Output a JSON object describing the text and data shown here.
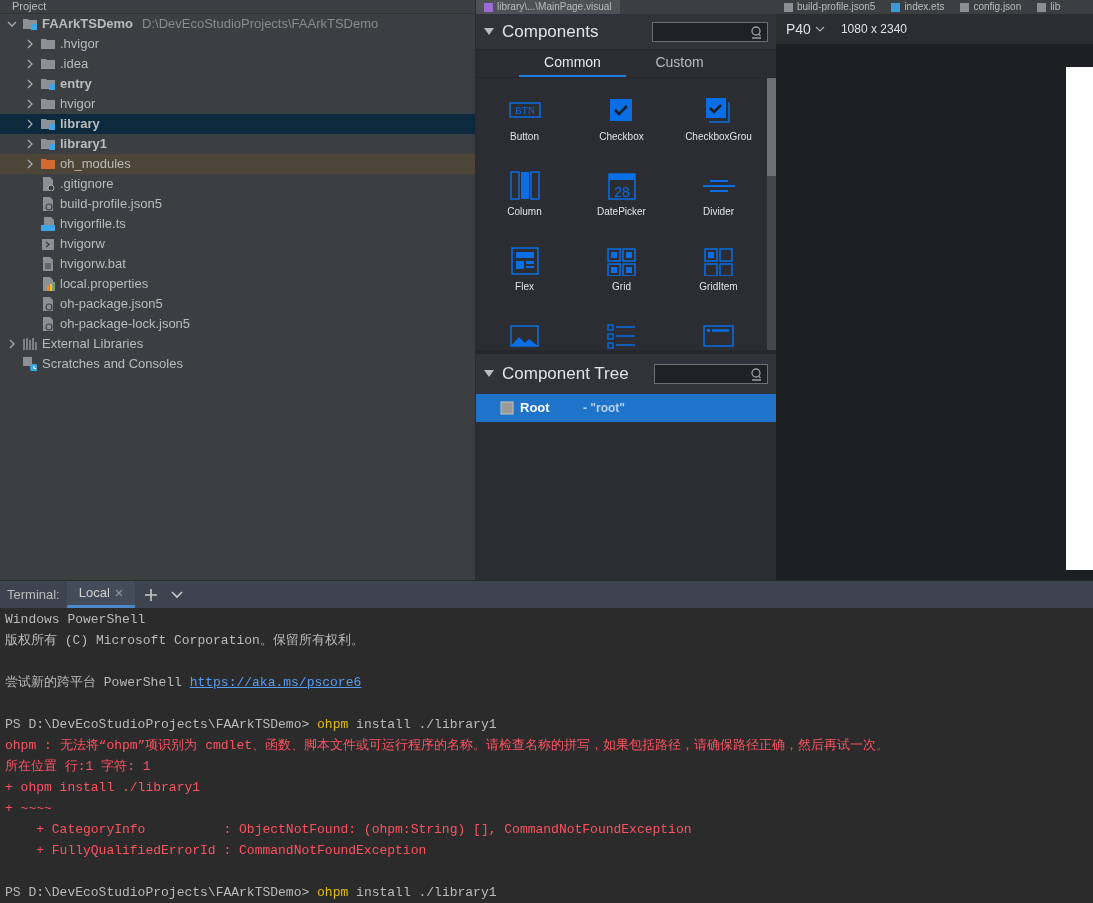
{
  "project_header": {
    "title": "Project"
  },
  "editor_tabs": [
    {
      "label": "library\\...\\MainPage.visual",
      "kind": "visual",
      "selected": true
    },
    {
      "label": "build-profile.json5",
      "kind": "json",
      "selected": false
    },
    {
      "label": "index.ets",
      "kind": "ets",
      "selected": false
    },
    {
      "label": "config.json",
      "kind": "json",
      "selected": false
    },
    {
      "label": "lib",
      "kind": "json",
      "selected": false
    }
  ],
  "project_tree": [
    {
      "label": "FAArkTSDemo",
      "path": "D:\\DevEcoStudioProjects\\FAArkTSDemo",
      "kind": "module",
      "expanded": true,
      "selected": false,
      "highlighted": false,
      "children": [
        {
          "label": ".hvigor",
          "kind": "folder",
          "expanded": false,
          "selected": false,
          "highlighted": false
        },
        {
          "label": ".idea",
          "kind": "folder",
          "expanded": false,
          "selected": false,
          "highlighted": false
        },
        {
          "label": "entry",
          "kind": "module",
          "expanded": false,
          "selected": false,
          "highlighted": false
        },
        {
          "label": "hvigor",
          "kind": "folder",
          "expanded": false,
          "selected": false,
          "highlighted": false
        },
        {
          "label": "library",
          "kind": "module",
          "expanded": false,
          "selected": true
        },
        {
          "label": "library1",
          "kind": "module",
          "expanded": false,
          "selected": false,
          "highlighted": false
        },
        {
          "label": "oh_modules",
          "kind": "excluded",
          "expanded": false,
          "selected": false,
          "highlighted": true
        },
        {
          "label": ".gitignore",
          "kind": "ignore",
          "selected": false,
          "highlighted": false
        },
        {
          "label": "build-profile.json5",
          "kind": "json",
          "selected": false,
          "highlighted": false
        },
        {
          "label": "hvigorfile.ts",
          "kind": "ts",
          "selected": false,
          "highlighted": false
        },
        {
          "label": "hvigorw",
          "kind": "script",
          "selected": false,
          "highlighted": false
        },
        {
          "label": "hvigorw.bat",
          "kind": "text",
          "selected": false,
          "highlighted": false
        },
        {
          "label": "local.properties",
          "kind": "properties",
          "selected": false,
          "highlighted": false
        },
        {
          "label": "oh-package.json5",
          "kind": "json",
          "selected": false,
          "highlighted": false
        },
        {
          "label": "oh-package-lock.json5",
          "kind": "json",
          "selected": false,
          "highlighted": false
        }
      ]
    },
    {
      "label": "External Libraries",
      "kind": "libraries",
      "expanded": false,
      "selected": false,
      "highlighted": false
    },
    {
      "label": "Scratches and Consoles",
      "kind": "scratches",
      "selected": false,
      "highlighted": false
    }
  ],
  "components_panel": {
    "title": "Components",
    "expanded": true,
    "tabs": [
      {
        "label": "Common",
        "selected": true
      },
      {
        "label": "Custom",
        "selected": false
      }
    ],
    "items": [
      {
        "label": "Button",
        "kind": "button",
        "icon_text": "BTN"
      },
      {
        "label": "Checkbox",
        "kind": "checkbox"
      },
      {
        "label": "CheckboxGrou",
        "kind": "checkbox-group"
      },
      {
        "label": "Column",
        "kind": "column"
      },
      {
        "label": "DatePicker",
        "kind": "datepicker",
        "icon_text": "28"
      },
      {
        "label": "Divider",
        "kind": "divider"
      },
      {
        "label": "Flex",
        "kind": "flex"
      },
      {
        "label": "Grid",
        "kind": "grid"
      },
      {
        "label": "GridItem",
        "kind": "griditem"
      },
      {
        "kind": "image"
      },
      {
        "kind": "list"
      },
      {
        "kind": "panel"
      }
    ]
  },
  "component_tree": {
    "title": "Component Tree",
    "expanded": true,
    "nodes": [
      {
        "label": "Root",
        "id_label": "- \"root\"",
        "selected": true
      }
    ]
  },
  "preview": {
    "device": "P40",
    "resolution": "1080 x 2340"
  },
  "terminal": {
    "title": "Terminal:",
    "tabs": [
      {
        "label": "Local",
        "selected": true
      }
    ],
    "lines": [
      {
        "space_before": false,
        "segments": [
          {
            "text": "Windows PowerShell",
            "kind": "plain"
          }
        ]
      },
      {
        "space_before": false,
        "segments": [
          {
            "text": "版权所有 (C) Microsoft Corporation。保留所有权利。",
            "kind": "plain"
          }
        ]
      },
      {
        "space_before": true,
        "segments": [
          {
            "text": "尝试新的跨平台 PowerShell ",
            "kind": "plain"
          },
          {
            "text": "https://aka.ms/pscore6",
            "kind": "link"
          }
        ]
      },
      {
        "space_before": true,
        "segments": [
          {
            "text": "PS D:\\DevEcoStudioProjects\\FAArkTSDemo> ",
            "kind": "plain"
          },
          {
            "text": "ohpm",
            "kind": "command"
          },
          {
            "text": " install ./library1",
            "kind": "plain"
          }
        ]
      },
      {
        "space_before": false,
        "segments": [
          {
            "text": "ohpm : 无法将“ohpm”项识别为 cmdlet、函数、脚本文件或可运行程序的名称。请检查名称的拼写，如果包括路径，请确保路径正确，然后再试一次。",
            "kind": "error"
          }
        ]
      },
      {
        "space_before": false,
        "segments": [
          {
            "text": "所在位置 行:1 字符: 1",
            "kind": "error"
          }
        ]
      },
      {
        "space_before": false,
        "segments": [
          {
            "text": "+ ohpm install ./library1",
            "kind": "error"
          }
        ]
      },
      {
        "space_before": false,
        "segments": [
          {
            "text": "+ ~~~~",
            "kind": "error"
          }
        ]
      },
      {
        "space_before": false,
        "segments": [
          {
            "text": "    + CategoryInfo          : ObjectNotFound: (ohpm:String) [], CommandNotFoundException",
            "kind": "error"
          }
        ]
      },
      {
        "space_before": false,
        "segments": [
          {
            "text": "    + FullyQualifiedErrorId : CommandNotFoundException",
            "kind": "error"
          }
        ]
      },
      {
        "space_before": true,
        "segments": [
          {
            "text": "PS D:\\DevEcoStudioProjects\\FAArkTSDemo> ",
            "kind": "plain"
          },
          {
            "text": "ohpm",
            "kind": "command"
          },
          {
            "text": " install ./library1",
            "kind": "plain"
          }
        ]
      }
    ]
  }
}
